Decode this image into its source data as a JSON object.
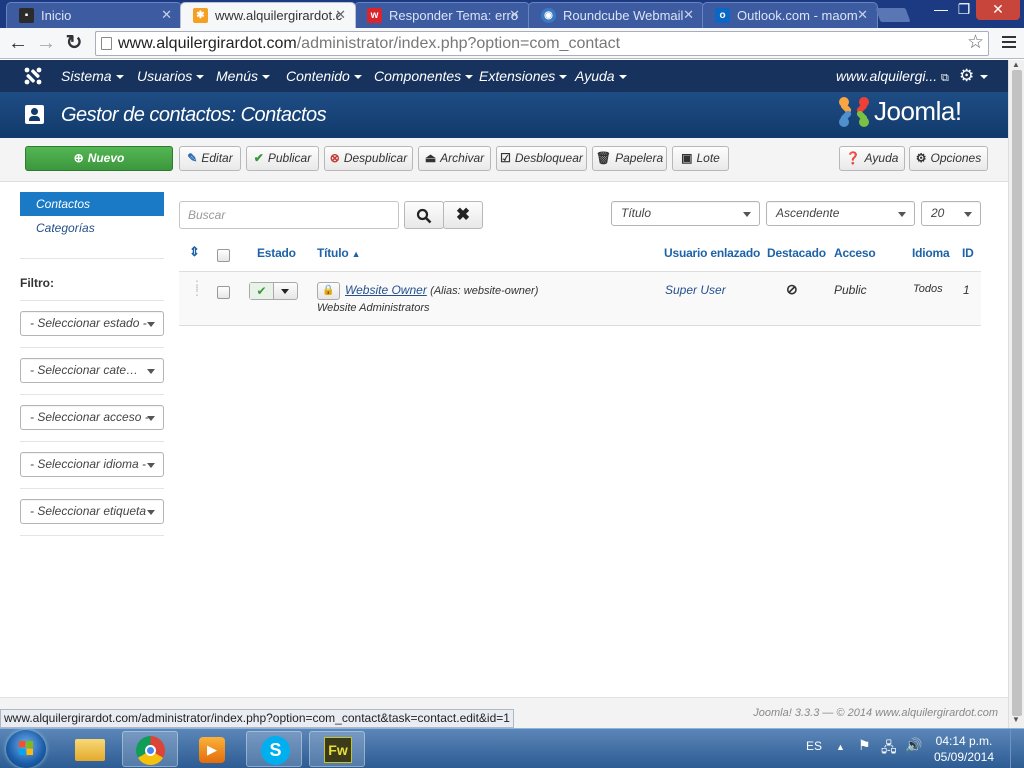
{
  "browser": {
    "tabs": [
      {
        "label": "Inicio",
        "icon": "joomla-icon",
        "active": false
      },
      {
        "label": "www.alquilergirardot.c",
        "icon": "joomla-icon",
        "active": true
      },
      {
        "label": "Responder Tema: erro",
        "icon": "forum-icon",
        "active": false
      },
      {
        "label": "Roundcube Webmail",
        "icon": "roundcube-icon",
        "active": false
      },
      {
        "label": "Outlook.com - maom",
        "icon": "outlook-icon",
        "active": false
      }
    ],
    "url_host": "www.alquilergirardot.com",
    "url_path": "/administrator/index.php?option=com_contact",
    "status_url": "www.alquilergirardot.com/administrator/index.php?option=com_contact&task=contact.edit&id=1"
  },
  "nav": {
    "menus": [
      "Sistema",
      "Usuarios",
      "Menús",
      "Contenido",
      "Componentes",
      "Extensiones",
      "Ayuda"
    ],
    "site_label": "www.alquilergi...",
    "settings_icon": "gear-icon"
  },
  "header": {
    "title": "Gestor de contactos: Contactos",
    "logo_text": "Joomla!"
  },
  "toolbar": {
    "new": "Nuevo",
    "edit": "Editar",
    "publish": "Publicar",
    "unpublish": "Despublicar",
    "archive": "Archivar",
    "checkin": "Desbloquear",
    "trash": "Papelera",
    "batch": "Lote",
    "help": "Ayuda",
    "options": "Opciones"
  },
  "sidebar": {
    "items": [
      "Contactos",
      "Categorías"
    ],
    "filter_title": "Filtro:",
    "filters": [
      "- Seleccionar estado -",
      "- Seleccionar categoría -",
      "- Seleccionar acceso -",
      "- Seleccionar idioma -",
      "- Seleccionar etiqueta -"
    ]
  },
  "search": {
    "placeholder": "Buscar",
    "sort_field": "Título",
    "sort_direction": "Ascendente",
    "limit": "20"
  },
  "table": {
    "headers": {
      "status": "Estado",
      "title": "Título",
      "linked_user": "Usuario enlazado",
      "featured": "Destacado",
      "access": "Acceso",
      "language": "Idioma",
      "id": "ID"
    },
    "rows": [
      {
        "name": "Website Owner",
        "alias": "(Alias: website-owner)",
        "category": "Website Administrators",
        "linked_user": "Super User",
        "access": "Public",
        "language": "Todos",
        "id": "1"
      }
    ]
  },
  "footer": {
    "version": "Joomla! 3.3.3 — © 2014 www.alquilergirardot.com"
  },
  "taskbar": {
    "language": "ES",
    "time": "04:14 p.m.",
    "date": "05/09/2014",
    "fw_label": "Fw"
  }
}
